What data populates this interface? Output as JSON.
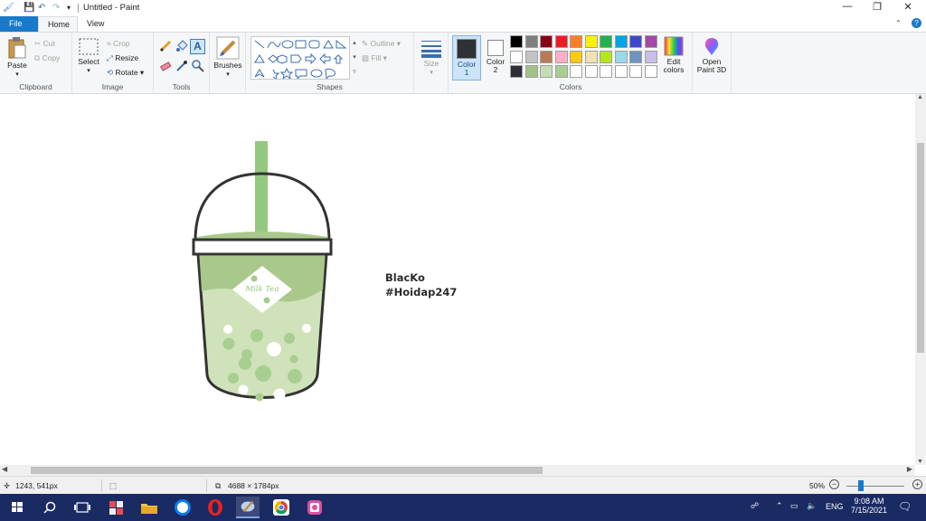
{
  "window": {
    "title": "Untitled - Paint",
    "controls": {
      "minimize": "—",
      "restore": "❐",
      "close": "✕"
    }
  },
  "tabs": {
    "file": "File",
    "home": "Home",
    "view": "View"
  },
  "ribbon": {
    "clipboard": {
      "paste": "Paste",
      "cut": "Cut",
      "copy": "Copy",
      "label": "Clipboard"
    },
    "image": {
      "select": "Select",
      "crop": "Crop",
      "resize": "Resize",
      "rotate": "Rotate",
      "label": "Image"
    },
    "tools": {
      "label": "Tools"
    },
    "brushes": {
      "label": "Brushes"
    },
    "shapes": {
      "outline": "Outline",
      "fill": "Fill",
      "label": "Shapes"
    },
    "size": {
      "label": "Size"
    },
    "color1": {
      "line1": "Color",
      "line2": "1"
    },
    "color2": {
      "line1": "Color",
      "line2": "2"
    },
    "colors_label": "Colors",
    "edit_colors": {
      "line1": "Edit",
      "line2": "colors"
    },
    "paint3d": {
      "line1": "Open",
      "line2": "Paint 3D"
    },
    "palette_row1": [
      "#000000",
      "#7f7f7f",
      "#880015",
      "#ed1c24",
      "#ff7f27",
      "#fff200",
      "#22b14c",
      "#00a2e8",
      "#3f48cc",
      "#a349a4"
    ],
    "palette_row2": [
      "#ffffff",
      "#c3c3c3",
      "#b97a57",
      "#ffaec9",
      "#ffc90e",
      "#efe4b0",
      "#b5e61d",
      "#99d9ea",
      "#7092be",
      "#c8bfe7"
    ],
    "palette_row3": [
      "#2e2e36",
      "#a1c286",
      "#c6dcb4",
      "#a8cf8f",
      "#ffffff",
      "#ffffff",
      "#ffffff",
      "#ffffff",
      "#ffffff",
      "#ffffff"
    ]
  },
  "canvas": {
    "text_line1": "BlacKo",
    "text_line2": "#Hoidap247",
    "label_text": "Milk Tea",
    "colors": {
      "cup_green": "#a9c98c",
      "liquid_light": "#cfe2b9",
      "outline": "#333333",
      "straw": "#93c97e"
    }
  },
  "status": {
    "cursor_pos": "1243, 541px",
    "image_size": "4688 × 1784px",
    "zoom": "50%"
  },
  "taskbar": {
    "lang": "ENG",
    "time": "9:08 AM",
    "date": "7/15/2021"
  }
}
